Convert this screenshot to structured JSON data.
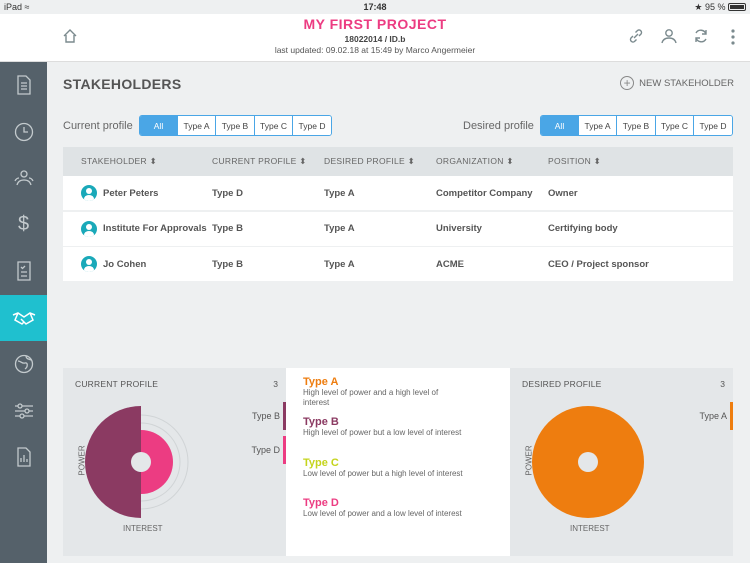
{
  "status": {
    "device": "iPad",
    "time": "17:48",
    "battery": "95 %"
  },
  "header": {
    "project_title": "MY FIRST PROJECT",
    "project_id": "18022014 / ID.b",
    "last_updated": "last updated: 09.02.18 at 15:49 by Marco Angermeier"
  },
  "page": {
    "title": "STAKEHOLDERS",
    "new_button": "NEW STAKEHOLDER"
  },
  "filters": {
    "current_label": "Current profile",
    "desired_label": "Desired profile",
    "options": [
      "All",
      "Type A",
      "Type B",
      "Type C",
      "Type D"
    ],
    "current_selected": "All",
    "desired_selected": "All"
  },
  "table": {
    "columns": [
      "STAKEHOLDER ⬍",
      "CURRENT PROFILE ⬍",
      "DESIRED PROFILE ⬍",
      "ORGANIZATION ⬍",
      "POSITION ⬍"
    ],
    "rows": [
      {
        "name": "Peter Peters",
        "current": "Type D",
        "desired": "Type A",
        "org": "Competitor Company",
        "position": "Owner"
      },
      {
        "name": "Institute For Approvals",
        "current": "Type B",
        "desired": "Type A",
        "org": "University",
        "position": "Certifying body"
      },
      {
        "name": "Jo Cohen",
        "current": "Type B",
        "desired": "Type A",
        "org": "ACME",
        "position": "CEO / Project sponsor"
      }
    ]
  },
  "current_card": {
    "title": "CURRENT PROFILE",
    "count": "3",
    "x_axis": "INTEREST",
    "y_axis": "POWER",
    "legend": [
      {
        "label": "Type B",
        "color": "#8b3a62"
      },
      {
        "label": "Type D",
        "color": "#ec3c82"
      }
    ]
  },
  "desired_card": {
    "title": "DESIRED PROFILE",
    "count": "3",
    "x_axis": "INTEREST",
    "y_axis": "POWER",
    "legend": [
      {
        "label": "Type A",
        "color": "#ee7d0f"
      }
    ]
  },
  "types": [
    {
      "name": "Type A",
      "desc": "High level of power and a high level of interest",
      "color": "#ee7d0f"
    },
    {
      "name": "Type B",
      "desc": "High level of power but a low level of interest",
      "color": "#8b3a62"
    },
    {
      "name": "Type C",
      "desc": "Low level of power but a high level of interest",
      "color": "#c5d41c"
    },
    {
      "name": "Type D",
      "desc": "Low level of power and a low level of interest",
      "color": "#ec3c82"
    }
  ],
  "colors": {
    "accent": "#1fc0cf",
    "segment": "#4aa6e6",
    "sidebar": "#55616a"
  },
  "icons": {
    "header_left": "home-icon",
    "header_right": [
      "link-icon",
      "people-icon",
      "sync-icon",
      "more-vertical-icon"
    ],
    "sidebar": [
      "document-icon",
      "clock-icon",
      "team-icon",
      "dollar-icon",
      "checklist-icon",
      "handshake-icon",
      "globe-icon",
      "sliders-icon",
      "report-icon"
    ]
  }
}
